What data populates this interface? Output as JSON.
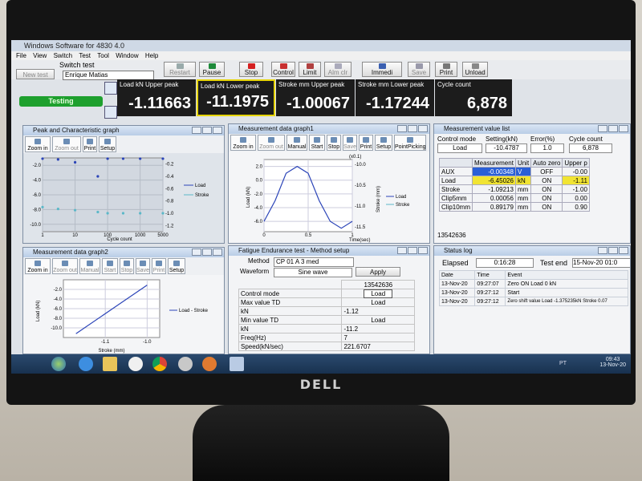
{
  "app": {
    "title": "Windows Software for 4830 4.0",
    "menu": [
      "File",
      "View",
      "Switch",
      "Test",
      "Tool",
      "Window",
      "Help"
    ],
    "switch_label": "Switch test",
    "switch_value": "Enrique Matias",
    "new_test": "New test",
    "status": "Testing"
  },
  "toolbar": {
    "restart": "Restart",
    "pause": "Pause",
    "stop": "Stop",
    "control": "Control",
    "limit": "Limit",
    "alm_clr": "Alm clr",
    "immedi": "Immedi",
    "save": "Save",
    "print": "Print",
    "unload": "Unload"
  },
  "peaks": [
    {
      "label": "Load kN Upper peak",
      "value": "-1.11663"
    },
    {
      "label": "Load kN Lower peak",
      "value": "-11.1975"
    },
    {
      "label": "Stroke mm Upper peak",
      "value": "-1.00067"
    },
    {
      "label": "Stroke mm Lower peak",
      "value": "-1.17244"
    },
    {
      "label": "Cycle count",
      "value": "6,878"
    }
  ],
  "graph_buttons": {
    "zoom_in": "Zoom in",
    "zoom_out": "Zoom out",
    "manual": "Manual",
    "start": "Start",
    "stop": "Stop",
    "save": "Save",
    "print": "Print",
    "setup": "Setup",
    "point_picking": "PointPicking"
  },
  "peak_graph": {
    "title": "Peak and Characteristic graph",
    "xlabel": "Cycle count",
    "legend": [
      "Load",
      "Stroke"
    ]
  },
  "meas_graph1": {
    "title": "Measurement data graph1",
    "xlabel": "Time(sec)",
    "ylabel_left": "Load (kN)",
    "ylabel_right": "Stroke (mm)",
    "scale_note": "(x0.1)",
    "legend": [
      "Load",
      "Stroke"
    ]
  },
  "meas_graph2": {
    "title": "Measurement data graph2",
    "xlabel": "Stroke (mm)",
    "ylabel": "Load (kN)",
    "legend": [
      "Load - Stroke"
    ]
  },
  "chart_data": [
    {
      "type": "scatter",
      "title": "Peak and Characteristic graph",
      "xlabel": "Cycle count",
      "xscale": "log",
      "x_ticks": [
        "1",
        "10",
        "100",
        "1000",
        "5000"
      ],
      "y_left_ticks": [
        "-2.0",
        "-4.0",
        "-6.0",
        "-8.0",
        "-10.0"
      ],
      "y_right_ticks": [
        "-0.2",
        "-0.4",
        "-0.6",
        "-0.8",
        "-1.0",
        "-1.2"
      ],
      "series": [
        {
          "name": "Load",
          "x": [
            1,
            3,
            10,
            50,
            100,
            300,
            1000,
            5000
          ],
          "y": [
            -1.1,
            -1.2,
            -1.6,
            -3.5,
            -1.1,
            -1.1,
            -1.1,
            -1.1
          ]
        },
        {
          "name": "Stroke",
          "x": [
            1,
            3,
            10,
            50,
            100,
            300,
            1000,
            5000
          ],
          "y": [
            -0.9,
            -0.93,
            -0.95,
            -0.98,
            -1.0,
            -1.0,
            -1.0,
            -1.0
          ]
        }
      ]
    },
    {
      "type": "line",
      "title": "Measurement data graph1",
      "xlabel": "Time(sec)",
      "ylabel": "Load (kN)",
      "y2label": "Stroke (mm)",
      "x_ticks": [
        "0",
        "0.5",
        "1"
      ],
      "y_left_ticks": [
        "2.0",
        "0.0",
        "-2.0",
        "-4.0",
        "-6.0"
      ],
      "y_right_ticks": [
        "-10.0",
        "-10.5",
        "-11.0",
        "-11.5"
      ],
      "series": [
        {
          "name": "Load",
          "x": [
            0,
            0.125,
            0.25,
            0.375,
            0.5,
            0.625,
            0.75,
            0.875,
            1
          ],
          "y": [
            -6.0,
            -3.0,
            1.0,
            2.0,
            1.0,
            -3.0,
            -6.0,
            -7.0,
            -6.0
          ]
        }
      ]
    },
    {
      "type": "line",
      "title": "Measurement data graph2",
      "xlabel": "Stroke (mm)",
      "ylabel": "Load (kN)",
      "x_ticks": [
        "-1.1",
        "-1.0"
      ],
      "y_ticks": [
        "-2.0",
        "-4.0",
        "-6.0",
        "-8.0",
        "-10.0"
      ],
      "series": [
        {
          "name": "Load - Stroke",
          "x": [
            -1.17,
            -1.0
          ],
          "y": [
            -11.2,
            -1.1
          ]
        }
      ]
    }
  ],
  "meas_list": {
    "title": "Measurement value list",
    "control_mode_label": "Control mode",
    "control_mode": "Load",
    "setting_label": "Setting(kN)",
    "setting": "-10.4787",
    "error_label": "Error(%)",
    "error": "1.0",
    "cycle_label": "Cycle count",
    "cycle": "6,878",
    "headers": [
      "Measurement",
      "Unit",
      "Auto zero",
      "Upper p"
    ],
    "rows": [
      {
        "name": "AUX",
        "value": "-0.00348",
        "unit": "V",
        "auto": "OFF",
        "upper": "-0.00"
      },
      {
        "name": "Load",
        "value": "-6.45026",
        "unit": "kN",
        "auto": "ON",
        "upper": "-1.11"
      },
      {
        "name": "Stroke",
        "value": "-1.09213",
        "unit": "mm",
        "auto": "ON",
        "upper": "-1.00"
      },
      {
        "name": "Clip5mm",
        "value": "0.00056",
        "unit": "mm",
        "auto": "ON",
        "upper": "0.00"
      },
      {
        "name": "Clip10mm",
        "value": "0.89179",
        "unit": "mm",
        "auto": "ON",
        "upper": "0.90"
      }
    ],
    "footer_id": "13542636"
  },
  "fatigue": {
    "title": "Fatigue Endurance test - Method setup",
    "method_label": "Method",
    "method": "CP 01 A 3 med",
    "waveform_label": "Waveform",
    "waveform": "Sine wave",
    "apply": "Apply",
    "id": "13542636",
    "rows": [
      {
        "label": "Control mode",
        "value": "Load"
      },
      {
        "label": "Max value TD",
        "value": "Load"
      },
      {
        "label": "kN",
        "value": "-1.12"
      },
      {
        "label": "Min value TD",
        "value": "Load"
      },
      {
        "label": "kN",
        "value": "-11.2"
      },
      {
        "label": "Freq(Hz)",
        "value": "7"
      },
      {
        "label": "Speed(kN/sec)",
        "value": "221.6707"
      }
    ]
  },
  "status_log": {
    "title": "Status log",
    "elapsed_label": "Elapsed",
    "elapsed": "0:16:28",
    "test_end_label": "Test end",
    "test_end": "15-Nov-20 01:0",
    "headers": [
      "Date",
      "Time",
      "Event"
    ],
    "rows": [
      {
        "date": "13-Nov-20",
        "time": "09:27:07",
        "event": "Zero ON Load 0 kN"
      },
      {
        "date": "13-Nov-20",
        "time": "09:27:12",
        "event": "Start"
      },
      {
        "date": "13-Nov-20",
        "time": "09:27:12",
        "event": "Zero shift value Load -1.375235kN Stroke 0.07"
      }
    ]
  },
  "taskbar": {
    "time": "09:43",
    "date": "13-Nov-20",
    "lang": "PT"
  },
  "monitor": {
    "brand": "DELL"
  },
  "colors": {
    "load": "#2b44b8",
    "stroke": "#5bb8c8",
    "status_green": "#1ea02e",
    "highlight_yellow": "#f1e433"
  }
}
